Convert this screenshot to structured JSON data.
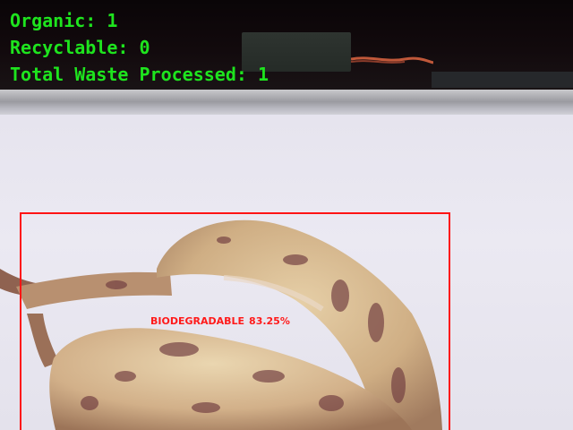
{
  "stats": {
    "organic": "Organic: 1",
    "recyclable": "Recyclable: 0",
    "total": "Total Waste Processed: 1"
  },
  "detection": {
    "class_label": "BIODEGRADABLE",
    "confidence": "83.25%"
  },
  "colors": {
    "stat_text": "#1ee41e",
    "bbox": "#ff1414",
    "label": "#ff1a1a"
  }
}
